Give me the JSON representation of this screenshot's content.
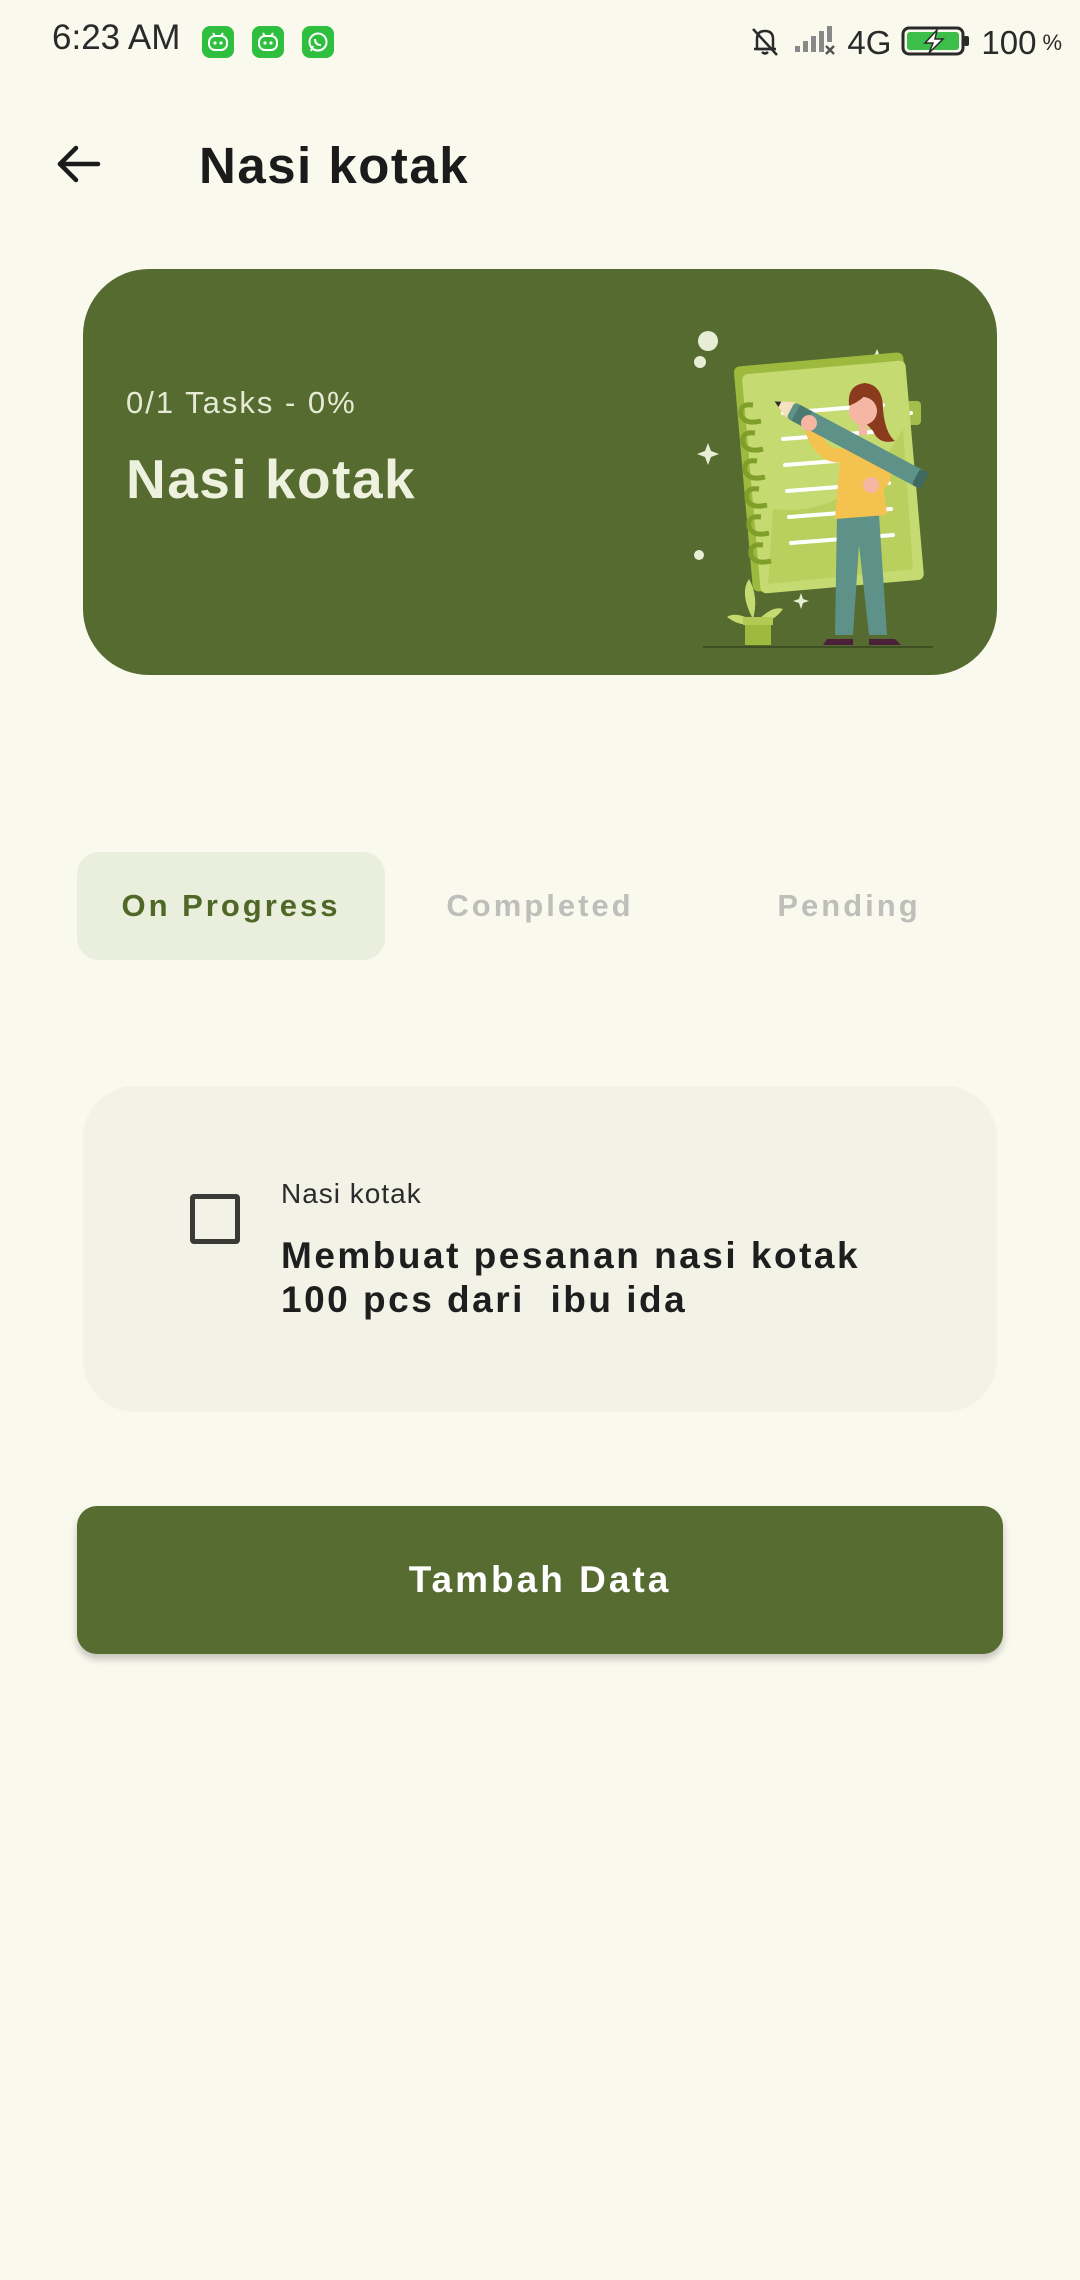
{
  "status_bar": {
    "time": "6:23 AM",
    "network": "4G",
    "battery": "100",
    "battery_unit": "%",
    "notification_icons": [
      "bot-app-icon",
      "bot-app-icon",
      "whatsapp-icon"
    ],
    "status_icons": [
      "bell-muted-icon",
      "signal-icon",
      "battery-charging-icon"
    ]
  },
  "header": {
    "title": "Nasi kotak",
    "back_icon": "arrow-left-icon"
  },
  "summary_card": {
    "progress_text": "0/1 Tasks - 0%",
    "title": "Nasi kotak",
    "illustration": "woman-with-pencil-and-notebook"
  },
  "tabs": [
    {
      "label": "On Progress",
      "active": true
    },
    {
      "label": "Completed",
      "active": false
    },
    {
      "label": "Pending",
      "active": false
    }
  ],
  "tasks": [
    {
      "category": "Nasi kotak",
      "description": "Membuat pesanan nasi kotak\n100 pcs dari  ibu ida",
      "checked": false
    }
  ],
  "actions": {
    "add_label": "Tambah Data"
  },
  "colors": {
    "background": "#FAF9EE",
    "primary": "#556B2F",
    "active_tab_bg": "#E9EFDC",
    "task_card_bg": "#F2F2E7"
  }
}
